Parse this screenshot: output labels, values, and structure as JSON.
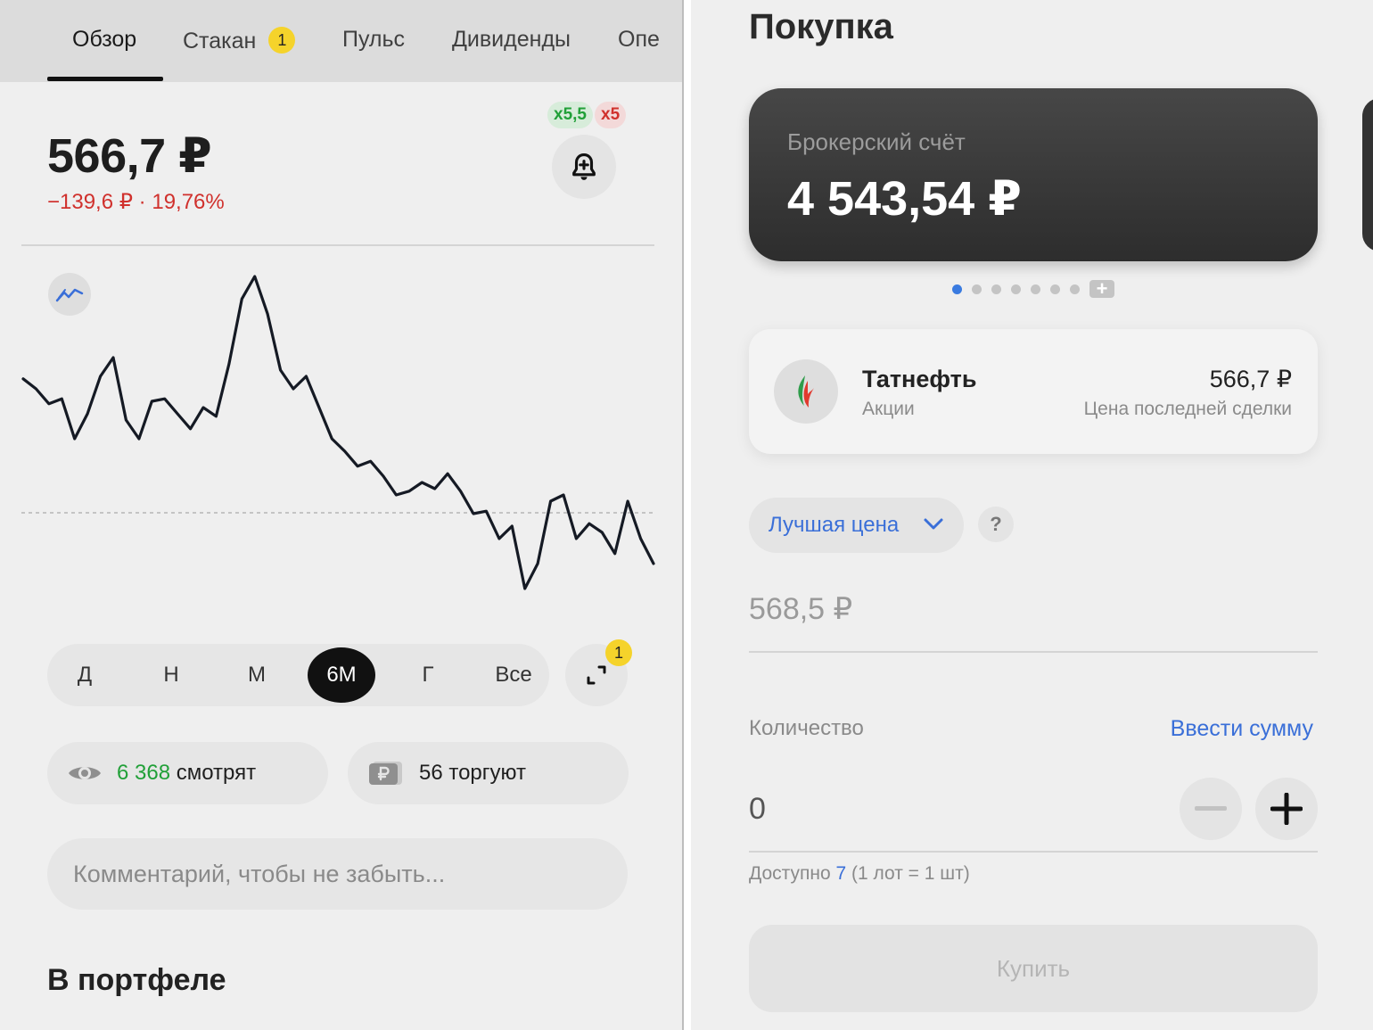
{
  "left": {
    "tabs": [
      {
        "label": "Обзор",
        "active": true
      },
      {
        "label": "Стакан",
        "badge": "1"
      },
      {
        "label": "Пульс"
      },
      {
        "label": "Дивиденды"
      },
      {
        "label": "Опе"
      }
    ],
    "quote": {
      "price": "566,7 ₽",
      "change": "−139,6 ₽ · 19,76%",
      "leverage_long": "x5,5",
      "leverage_short": "x5"
    },
    "chart_data": {
      "type": "line",
      "series": [
        {
          "values": [
            688,
            680,
            668,
            672,
            640,
            660,
            690,
            705,
            655,
            640,
            670,
            672,
            660,
            648,
            665,
            658,
            700,
            752,
            770,
            740,
            695,
            680,
            690,
            665,
            640,
            630,
            618,
            622,
            610,
            595,
            598,
            605,
            600,
            612,
            598,
            580,
            582,
            560,
            570,
            520,
            540,
            590,
            595,
            560,
            572,
            565,
            548,
            590,
            560,
            540
          ]
        }
      ],
      "colors": {
        "line": "#151a24",
        "baseline": "#b5b5b5",
        "change": "#d0312d",
        "up": "#21a038"
      }
    },
    "periods": [
      {
        "label": "Д"
      },
      {
        "label": "Н"
      },
      {
        "label": "М"
      },
      {
        "label": "6М",
        "active": true
      },
      {
        "label": "Г"
      },
      {
        "label": "Все"
      }
    ],
    "expand_badge": "1",
    "stats": {
      "watching_count": "6 368",
      "watching_label": "смотрят",
      "trading": "56 торгуют"
    },
    "comment_placeholder": "Комментарий, чтобы не забыть...",
    "portfolio_title": "В портфеле"
  },
  "right": {
    "title": "Покупка",
    "account": {
      "label": "Брокерский счёт",
      "balance": "4 543,54 ₽"
    },
    "ticker": {
      "name": "Татнефть",
      "type": "Акции",
      "price": "566,7 ₽",
      "price_label": "Цена последней сделки"
    },
    "order_type": "Лучшая цена",
    "help": "?",
    "limit_price": "568,5 ₽",
    "quantity_label": "Количество",
    "enter_sum": "Ввести сумму",
    "quantity": "0",
    "available_prefix": "Доступно",
    "available_count": "7",
    "available_suffix": "(1 лот = 1 шт)",
    "buy_label": "Купить",
    "icons": [
      "bell-plus-icon",
      "trend-icon",
      "expand-icon",
      "eye-icon",
      "ruble-card-icon",
      "chevron-down-icon",
      "minus-icon",
      "plus-icon",
      "tatneft-logo-icon"
    ]
  }
}
